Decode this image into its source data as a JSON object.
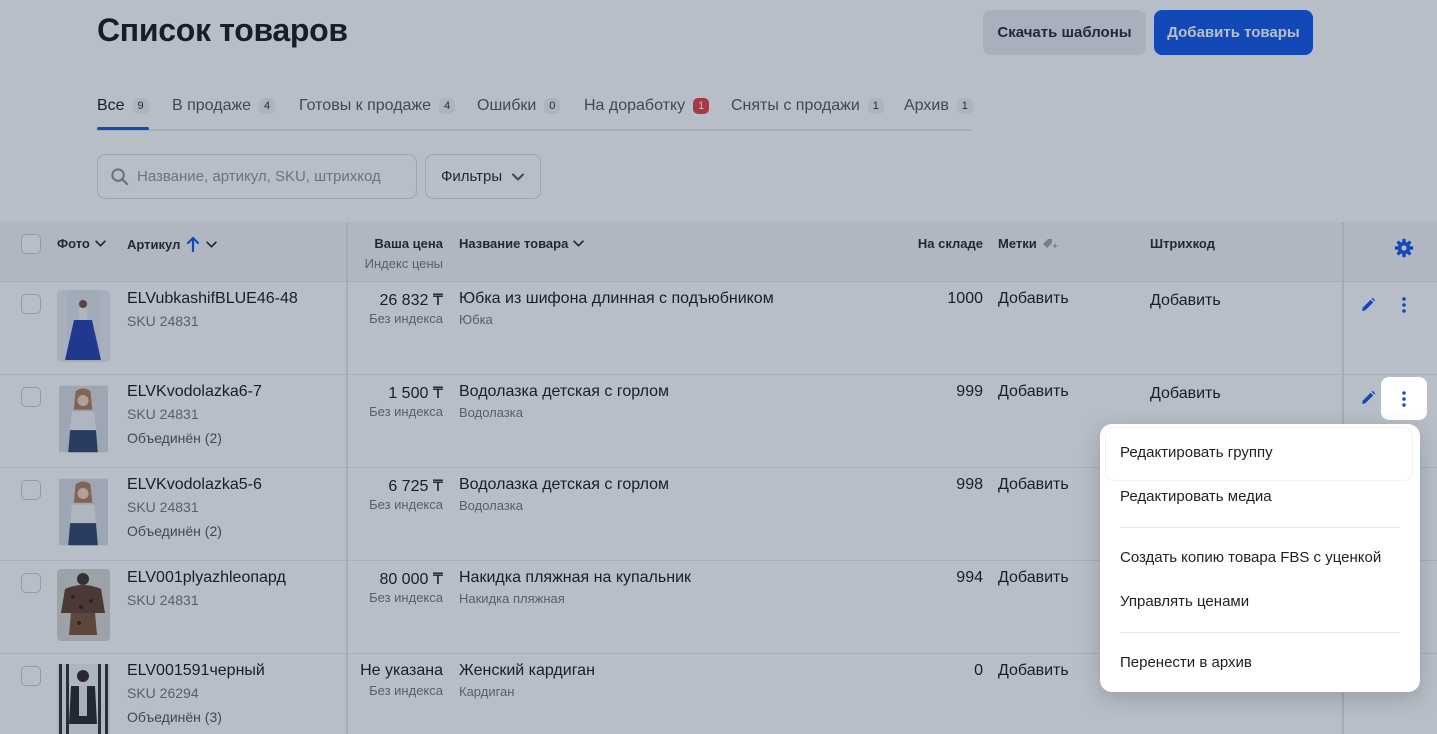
{
  "header": {
    "title": "Список товаров",
    "download_label": "Скачать шаблоны",
    "add_label": "Добавить товары"
  },
  "tabs": [
    {
      "label": "Все",
      "count": "9",
      "active": true
    },
    {
      "label": "В продаже",
      "count": "4"
    },
    {
      "label": "Готовы к продаже",
      "count": "4"
    },
    {
      "label": "Ошибки",
      "count": "0"
    },
    {
      "label": "На доработку",
      "count": "1",
      "alert": true
    },
    {
      "label": "Сняты с продажи",
      "count": "1"
    },
    {
      "label": "Архив",
      "count": "1"
    }
  ],
  "search": {
    "placeholder": "Название, артикул, SKU, штрихкод"
  },
  "filters_label": "Фильтры",
  "table": {
    "headers": {
      "photo": "Фото",
      "article": "Артикул",
      "price": "Ваша цена",
      "price_sub": "Индекс цены",
      "name": "Название товара",
      "stock": "На складе",
      "tags": "Метки",
      "barcode": "Штрихкод"
    },
    "rows": [
      {
        "article": "ELVubkashifBLUE46-48",
        "sku": "SKU 24831",
        "merged": "",
        "price": "26 832 ₸",
        "price_index": "Без индекса",
        "name": "Юбка из шифона длинная с подъюбником",
        "category": "Юбка",
        "stock": "1000",
        "tags": "Добавить",
        "barcode": "Добавить"
      },
      {
        "article": "ELVKvodolazka6-7",
        "sku": "SKU 24831",
        "merged": "Объединён (2)",
        "price": "1 500 ₸",
        "price_index": "Без индекса",
        "name": "Водолазка детская с горлом",
        "category": "Водолазка",
        "stock": "999",
        "tags": "Добавить",
        "barcode": "Добавить"
      },
      {
        "article": "ELVKvodolazka5-6",
        "sku": "SKU 24831",
        "merged": "Объединён (2)",
        "price": "6 725 ₸",
        "price_index": "Без индекса",
        "name": "Водолазка детская с горлом",
        "category": "Водолазка",
        "stock": "998",
        "tags": "Добавить",
        "barcode": ""
      },
      {
        "article": "ELV001plyazhleопард",
        "sku": "SKU 24831",
        "merged": "",
        "price": "80 000 ₸",
        "price_index": "Без индекса",
        "name": "Накидка пляжная на купальник",
        "category": "Накидка пляжная",
        "stock": "994",
        "tags": "Добавить",
        "barcode": ""
      },
      {
        "article": "ELV001591черный",
        "sku": "SKU 26294",
        "merged": "Объединён (3)",
        "price": "Не указана",
        "price_index": "Без индекса",
        "name": "Женский кардиган",
        "category": "Кардиган",
        "stock": "0",
        "tags": "Добавить",
        "barcode": ""
      }
    ]
  },
  "context_menu": {
    "items": [
      "Редактировать группу",
      "Редактировать медиа",
      "Создать копию товара FBS с уценкой",
      "Управлять ценами",
      "Перенести в архив"
    ]
  },
  "colors": {
    "accent": "#0a51e6",
    "alert": "#e23b3b",
    "overlay": "rgba(40,58,88,0.33)"
  }
}
